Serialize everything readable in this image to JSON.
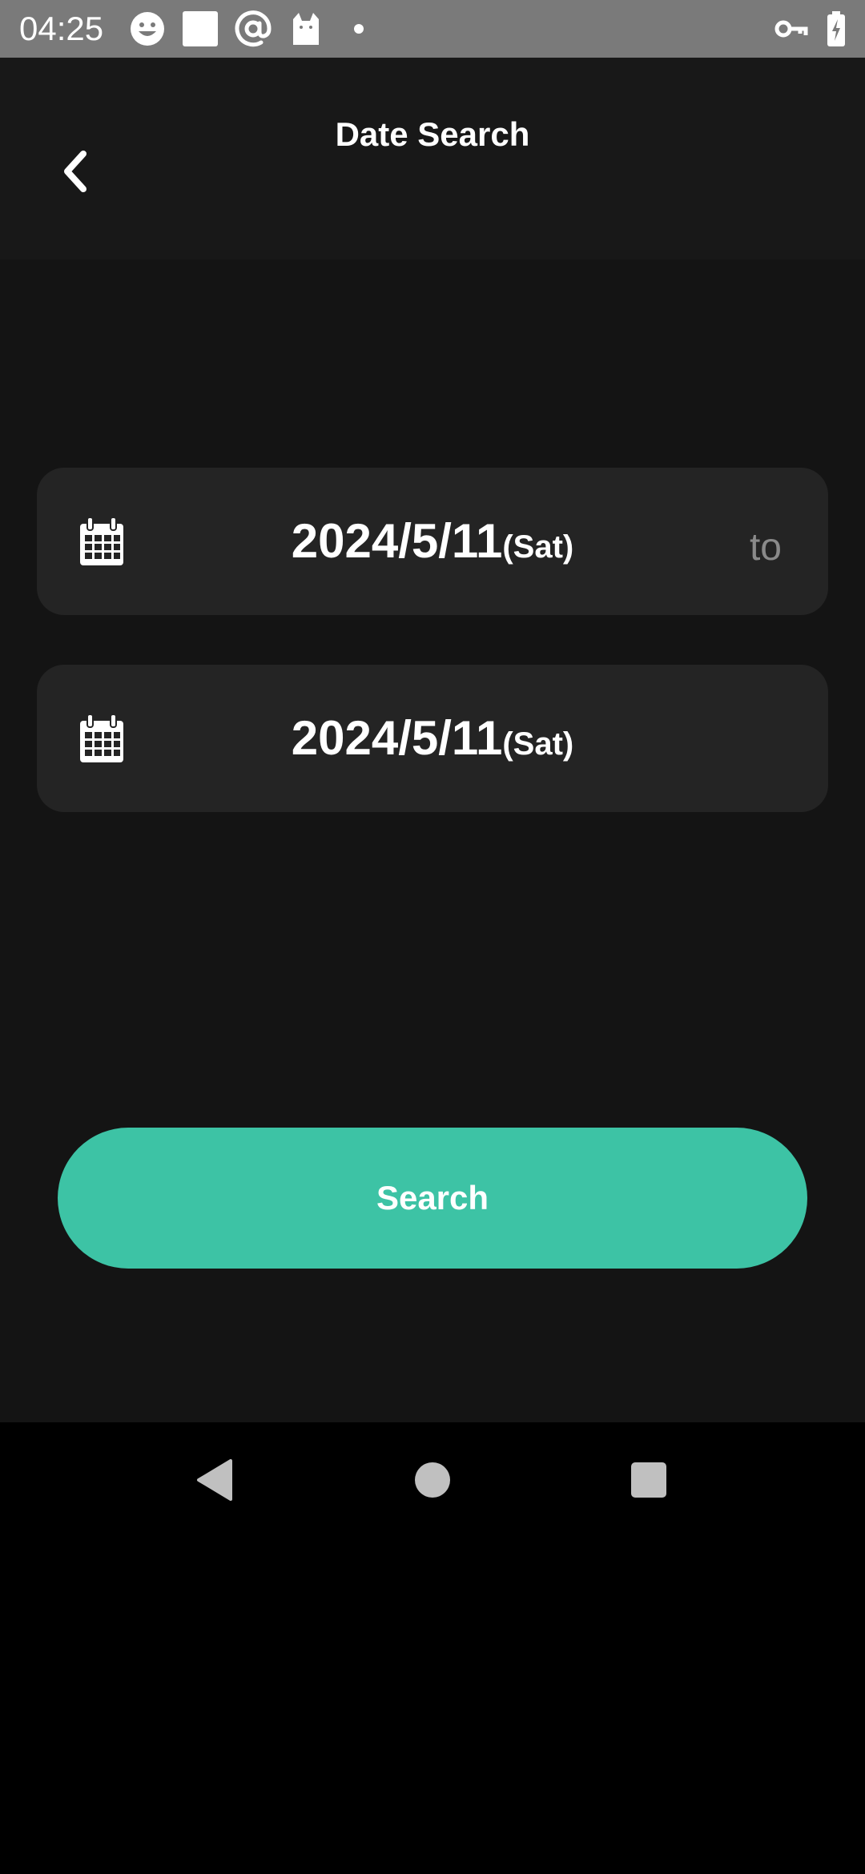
{
  "status_bar": {
    "time": "04:25",
    "icons": [
      "smiley-icon",
      "square-icon",
      "at-sign-icon",
      "cat-icon",
      "dot-icon",
      "vpn-key-icon",
      "battery-charging-icon"
    ]
  },
  "header": {
    "title": "Date Search",
    "back_icon": "chevron-left-icon"
  },
  "date_range": {
    "start": {
      "date": "2024/5/11",
      "day": "(Sat)",
      "icon": "calendar-icon"
    },
    "separator": "to",
    "end": {
      "date": "2024/5/11",
      "day": "(Sat)",
      "icon": "calendar-icon"
    }
  },
  "search_button": {
    "label": "Search"
  },
  "colors": {
    "background": "#141414",
    "header_background": "#181818",
    "field_background": "#242424",
    "accent": "#3dc3a5",
    "status_bar": "#7a7a7a",
    "separator_text": "#8a8a8a"
  },
  "nav_bar": {
    "buttons": [
      "nav-back-icon",
      "nav-home-icon",
      "nav-recents-icon"
    ]
  }
}
